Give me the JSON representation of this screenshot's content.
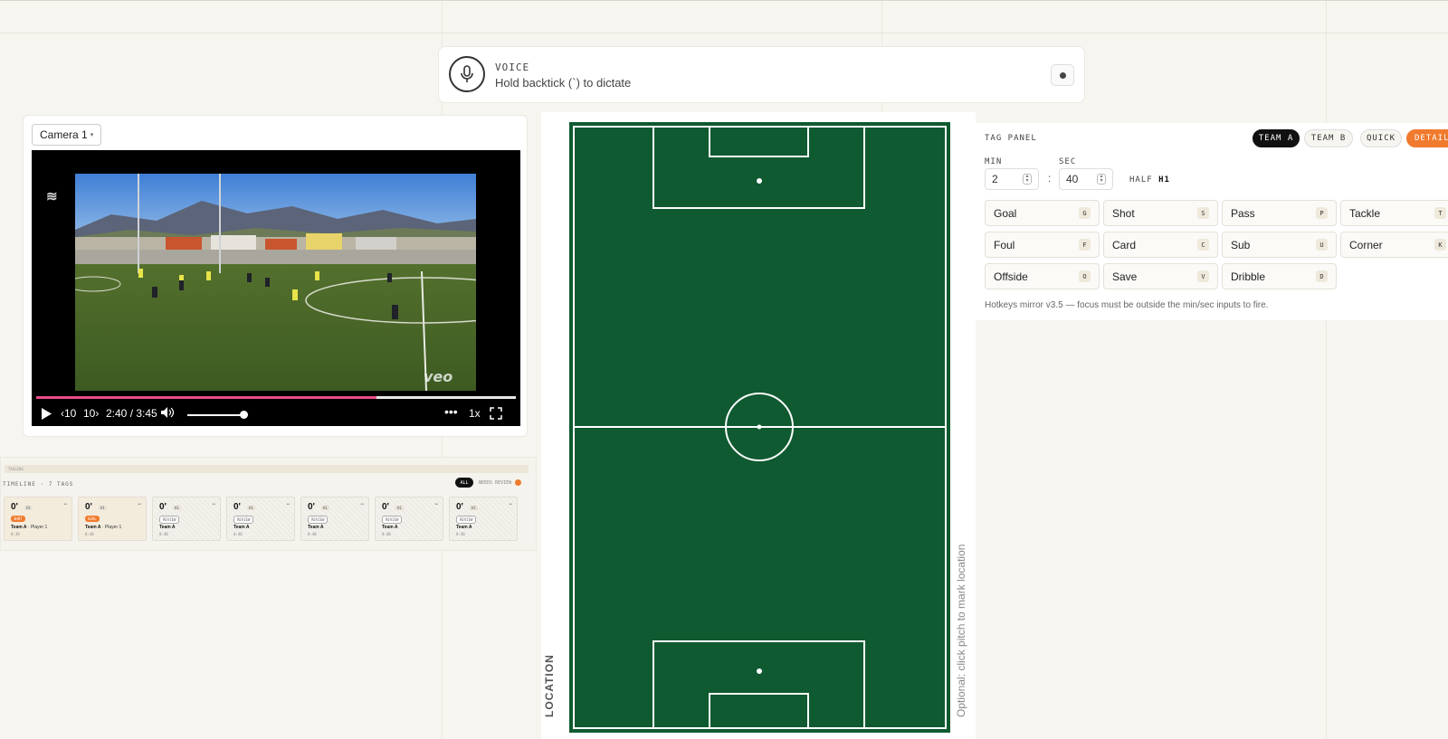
{
  "voice": {
    "label": "VOICE",
    "hint": "Hold backtick (`) to dictate"
  },
  "video": {
    "camera_select": "Camera 1",
    "time": "2:40 / 3:45",
    "skip_back": "10",
    "skip_forward": "10",
    "speed": "1x",
    "watermark": "veo",
    "progress_fraction": 0.71,
    "volume_fraction": 1.0
  },
  "timeline": {
    "strip_label": "TAGGING",
    "header": "TIMELINE · 7 TAGS",
    "filter_all": "ALL",
    "filter_review": "NEEDS REVIEW",
    "tags": [
      {
        "minute": "0'",
        "half": "H1",
        "badge": "SHOT",
        "team": "Team A",
        "player": "· Player 1",
        "time": "0:39"
      },
      {
        "minute": "0'",
        "half": "H1",
        "badge": "GOAL",
        "team": "Team A",
        "player": "· Player 1",
        "time": "0:40"
      },
      {
        "minute": "0'",
        "half": "H1",
        "badge": "REVIEW",
        "team": "Team A",
        "player": "",
        "time": "0:40"
      },
      {
        "minute": "0'",
        "half": "H1",
        "badge": "REVIEW",
        "team": "Team A",
        "player": "",
        "time": "0:40"
      },
      {
        "minute": "0'",
        "half": "H1",
        "badge": "REVIEW",
        "team": "Team A",
        "player": "",
        "time": "0:40"
      },
      {
        "minute": "0'",
        "half": "H1",
        "badge": "REVIEW",
        "team": "Team A",
        "player": "",
        "time": "0:40"
      },
      {
        "minute": "0'",
        "half": "H1",
        "badge": "REVIEW",
        "team": "Team A",
        "player": "",
        "time": "0:40"
      }
    ]
  },
  "pitch": {
    "location_label": "LOCATION",
    "hint": "Optional: click pitch to mark location",
    "color": "#0f5a31"
  },
  "tag_panel": {
    "title": "TAG PANEL",
    "team_a": "TEAM A",
    "team_b": "TEAM B",
    "mode_quick": "QUICK",
    "mode_detailed": "DETAILED",
    "min_label": "MIN",
    "min_value": "2",
    "sec_label": "SEC",
    "sec_value": "40",
    "colon": ":",
    "half_label": "HALF",
    "half_value": "H1",
    "events": [
      {
        "label": "Goal",
        "key": "G"
      },
      {
        "label": "Shot",
        "key": "S"
      },
      {
        "label": "Pass",
        "key": "P"
      },
      {
        "label": "Tackle",
        "key": "T"
      },
      {
        "label": "Foul",
        "key": "F"
      },
      {
        "label": "Card",
        "key": "C"
      },
      {
        "label": "Sub",
        "key": "U"
      },
      {
        "label": "Corner",
        "key": "K"
      },
      {
        "label": "Offside",
        "key": "O"
      },
      {
        "label": "Save",
        "key": "V"
      },
      {
        "label": "Dribble",
        "key": "D"
      }
    ],
    "footer": "Hotkeys mirror v3.5 — focus must be outside the min/sec inputs to fire."
  },
  "colors": {
    "accent_orange": "#f07a2d",
    "progress_pink": "#ec4a8b",
    "pitch_green": "#0f5a31"
  }
}
